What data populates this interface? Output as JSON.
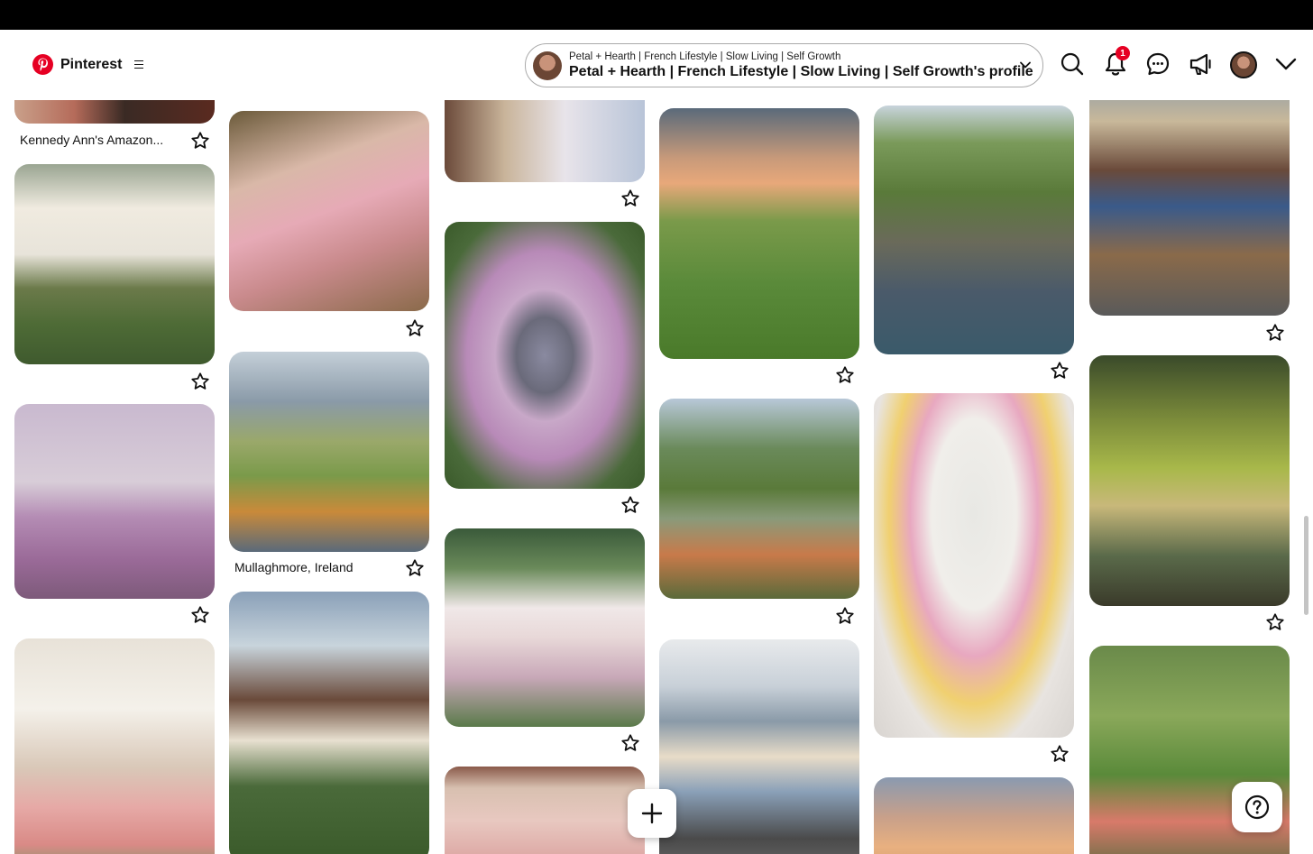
{
  "app": {
    "name": "Pinterest"
  },
  "profile_switcher": {
    "subtitle": "Petal + Hearth | French Lifestyle | Slow Living | Self Growth",
    "title": "Petal + Hearth | French Lifestyle | Slow Living | Self Growth's profile"
  },
  "header": {
    "notification_count": "1",
    "icons": [
      "search-icon",
      "bell-icon",
      "chat-icon",
      "megaphone-icon",
      "avatar",
      "chevron-down-icon"
    ]
  },
  "pins": {
    "caption_1": "Kennedy Ann's Amazon...",
    "caption_2": "Mullaghmore, Ireland"
  },
  "colors": {
    "brand": "#e60023",
    "badge": "#e60023"
  }
}
